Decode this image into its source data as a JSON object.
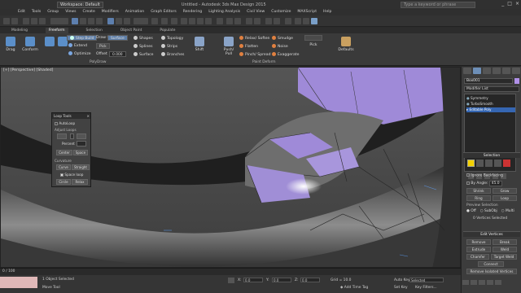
{
  "titlebar": {
    "workspace": "Workspace: Default",
    "title": "Untitled - Autodesk 3ds Max Design 2015",
    "search_placeholder": "Type a keyword or phrase",
    "controls": [
      "_",
      "□",
      "×"
    ]
  },
  "menu": [
    "Edit",
    "Tools",
    "Group",
    "Views",
    "Create",
    "Modifiers",
    "Animation",
    "Graph Editors",
    "Rendering",
    "Lighting Analysis",
    "Civil View",
    "Customize",
    "MAXScript",
    "Help"
  ],
  "ribbon_tabs": [
    "Modeling",
    "Freeform",
    "Selection",
    "Object Paint",
    "Populate"
  ],
  "ribbon_active_tab": "Freeform",
  "ribbon": {
    "drag": "Drag",
    "conform": "Conform",
    "step_build": "Step Build",
    "extend": "Extend",
    "optimize": "Optimize",
    "draw_on": "Draw On:",
    "surface": "Surface",
    "pick": "Pick",
    "offset_label": "Offset",
    "offset_value": "0.000",
    "shapes": "Shapes",
    "splines": "Splines",
    "surface2": "Surface",
    "topology": "Topology",
    "strips": "Strips",
    "branches": "Branches",
    "polydraw": "PolyDraw",
    "shift": "Shift",
    "push_pull": "Push/ Pull",
    "relax_soften": "Relax/ Soften",
    "flatten": "Flatten",
    "pinch_spread": "Pinch/ Spread",
    "smudge": "Smudge",
    "noise": "Noise",
    "exaggerate": "Exaggerate",
    "paint_deform": "Paint Deform",
    "pick2": "Pick",
    "defaults": "Defaults"
  },
  "viewport": {
    "label": "[+] [Perspective] [Shaded]"
  },
  "loop_tools": {
    "title": "Loop Tools",
    "close": "×",
    "autoloop": "AutoLoop",
    "adjust_loops": "Adjust Loops",
    "percent_label": "Percent",
    "center": "Center",
    "space": "Space",
    "curvature": "Curvature",
    "curve": "Curve",
    "straight": "Straight",
    "space_loop": "Space loop",
    "circle": "Circle",
    "relax": "Relax"
  },
  "command_panel": {
    "object_name": "Box001",
    "modifier_list": "Modifier List",
    "stack": [
      "Symmetry",
      "TurboSmooth",
      "Editable Poly"
    ],
    "stack_selected": 2,
    "selection_title": "Selection",
    "ignore_backfacing": "Ignore Backfacing",
    "by_angle": "By Angle:",
    "by_angle_value": "45.0",
    "shrink": "Shrink",
    "grow": "Grow",
    "ring": "Ring",
    "loop": "Loop",
    "preview_selection": "Preview Selection",
    "off": "Off",
    "subobj": "SubObj",
    "multi": "Multi",
    "selected_count": "0 Vertices Selected",
    "edit_vertices_title": "Edit Vertices",
    "remove": "Remove",
    "break": "Break",
    "extrude": "Extrude",
    "weld": "Weld",
    "chamfer": "Chamfer",
    "target_weld": "Target Weld",
    "connect": "Connect",
    "remove_isolated": "Remove Isolated Vertices"
  },
  "timeline": {
    "frame": "0 / 100"
  },
  "status": {
    "selected": "1 Object Selected",
    "prompt": "Move Tool",
    "x_label": "X:",
    "x_value": "0.0",
    "y_label": "Y:",
    "y_value": "0.0",
    "z_label": "Z:",
    "z_value": "0.0",
    "grid": "Grid = 10.0",
    "add_time_tag": "Add Time Tag",
    "auto_key": "Auto Key",
    "set_key": "Set Key",
    "selected_dropdown": "Selected",
    "key_filters": "Key Filters..."
  },
  "colors": {
    "accent": "#3566b2",
    "object_purple": "#9f8ad8",
    "model_dark": "#2a2a2a",
    "selected_yellow": "#f2d000"
  }
}
